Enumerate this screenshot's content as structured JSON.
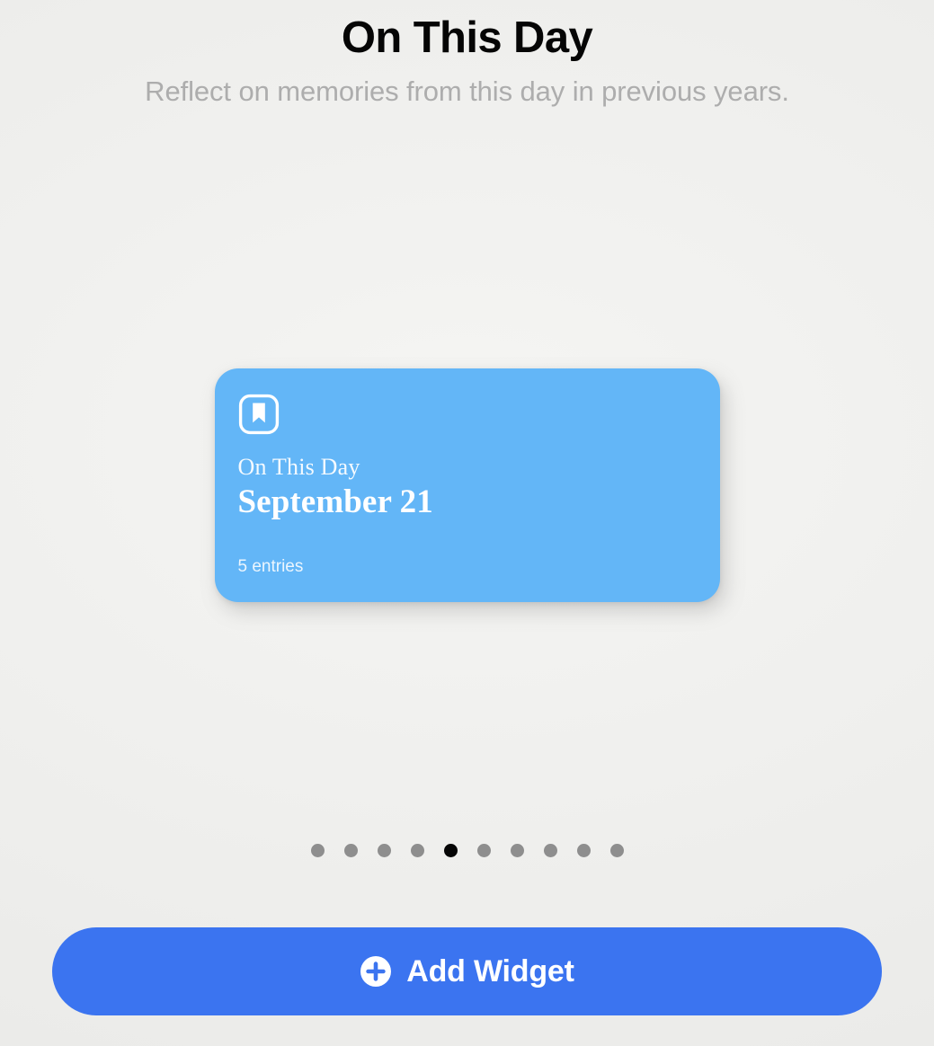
{
  "header": {
    "title": "On This Day",
    "subtitle": "Reflect on memories from this day in previous years."
  },
  "widget_preview": {
    "icon": "bookmark-book-icon",
    "label": "On This Day",
    "date": "September 21",
    "entries": "5 entries",
    "card_color": "#63b6f7"
  },
  "pagination": {
    "total": 10,
    "active_index": 4,
    "active_color": "#060606",
    "inactive_color": "#8e8e8e"
  },
  "footer": {
    "add_widget_label": "Add Widget",
    "add_widget_icon": "plus-circle-icon",
    "button_color": "#3b74f0"
  }
}
